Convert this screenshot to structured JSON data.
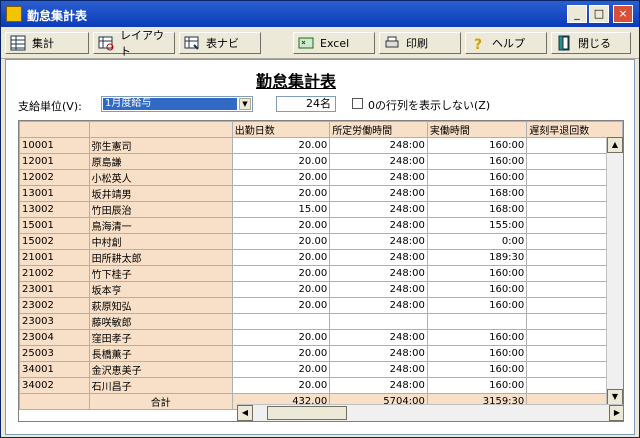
{
  "window": {
    "title": "勤怠集計表",
    "minimize": "_",
    "maximize": "□",
    "close": "×"
  },
  "toolbar": {
    "summary": "集計",
    "layout": "レイアウト",
    "table_nav": "表ナビ",
    "excel": "Excel",
    "print": "印刷",
    "help": "ヘルプ",
    "close": "閉じる"
  },
  "page_title": "勤怠集計表",
  "filters": {
    "pay_unit_label": "支給単位(V):",
    "pay_unit_value": "1月度給与",
    "count": "24名",
    "hide_zero_label": "0の行列を表示しない(Z)"
  },
  "columns": [
    "出勤日数",
    "所定労働時間",
    "実働時間",
    "遅刻早退回数"
  ],
  "rows": [
    [
      "10001",
      "弥生憲司",
      "20.00",
      "248:00",
      "160:00"
    ],
    [
      "12001",
      "原島謙",
      "20.00",
      "248:00",
      "160:00"
    ],
    [
      "12002",
      "小松英人",
      "20.00",
      "248:00",
      "160:00"
    ],
    [
      "13001",
      "坂井靖男",
      "20.00",
      "248:00",
      "168:00"
    ],
    [
      "13002",
      "竹田辰治",
      "15.00",
      "248:00",
      "168:00"
    ],
    [
      "15001",
      "鳥海清一",
      "20.00",
      "248:00",
      "155:00"
    ],
    [
      "15002",
      "中村創",
      "20.00",
      "248:00",
      "0:00"
    ],
    [
      "21001",
      "田所耕太郎",
      "20.00",
      "248:00",
      "189:30"
    ],
    [
      "21002",
      "竹下桂子",
      "20.00",
      "248:00",
      "160:00"
    ],
    [
      "23001",
      "坂本亨",
      "20.00",
      "248:00",
      "160:00"
    ],
    [
      "23002",
      "萩原知弘",
      "20.00",
      "248:00",
      "160:00"
    ],
    [
      "23003",
      "藤咲敏郎",
      "",
      "",
      ""
    ],
    [
      "23004",
      "窪田孝子",
      "20.00",
      "248:00",
      "160:00"
    ],
    [
      "25003",
      "長橋薫子",
      "20.00",
      "248:00",
      "160:00"
    ],
    [
      "34001",
      "金沢恵美子",
      "20.00",
      "248:00",
      "160:00"
    ],
    [
      "34002",
      "石川昌子",
      "20.00",
      "248:00",
      "160:00"
    ]
  ],
  "total": {
    "label": "合計",
    "values": [
      "432.00",
      "5704:00",
      "3159:30"
    ]
  },
  "scroll": {
    "up": "▲",
    "down": "▼",
    "left": "◀",
    "right": "▶"
  }
}
